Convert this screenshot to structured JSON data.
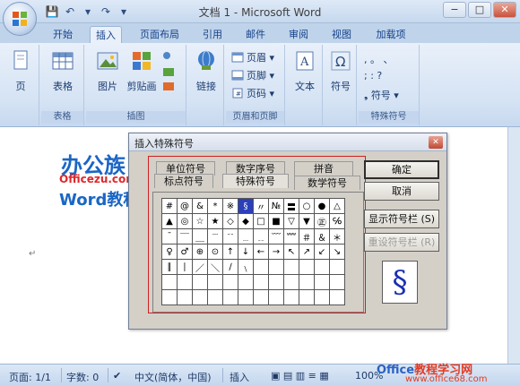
{
  "window": {
    "title": "文档 1 - Microsoft Word",
    "controls": [
      "−",
      "□",
      "✕"
    ]
  },
  "qat": [
    "💾",
    "↶",
    "▾",
    "↷",
    "▾"
  ],
  "tabs": [
    "开始",
    "插入",
    "页面布局",
    "引用",
    "邮件",
    "审阅",
    "视图",
    "加载项"
  ],
  "ribbon": {
    "groups": {
      "pages": {
        "label": "",
        "btn": "页"
      },
      "tables": {
        "label": "表格",
        "btn": "表格"
      },
      "illustrations": {
        "label": "插图",
        "picture": "图片",
        "clipart": "剪贴画"
      },
      "links": {
        "label": "",
        "btn": "链接"
      },
      "header_footer": {
        "label": "页眉和页脚",
        "header": "页眉",
        "footer": "页脚",
        "page_number": "页码"
      },
      "text": {
        "label": "",
        "btn": "文本"
      },
      "symbols": {
        "label": "",
        "btn": "符号"
      },
      "special": {
        "label": "特殊符号",
        "row1": ",  。  、",
        "row2": ";  :  ?",
        "btn": "符号"
      }
    }
  },
  "watermark": {
    "brand": "办公族",
    "site": "Officezu.com",
    "sub": "Word教程"
  },
  "dialog": {
    "title": "插入特殊符号",
    "tabs_row1": [
      "单位符号",
      "数字序号",
      "拼音"
    ],
    "tabs_row2": [
      "标点符号",
      "特殊符号",
      "数学符号"
    ],
    "symbols": [
      [
        "#",
        "@",
        "&",
        "*",
        "※",
        "§",
        "〃",
        "№",
        "〓",
        "○",
        "●",
        "△"
      ],
      [
        "▲",
        "◎",
        "☆",
        "★",
        "◇",
        "◆",
        "□",
        "■",
        "▽",
        "▼",
        "㊣",
        "℅"
      ],
      [
        "ˉ",
        "￣",
        "＿",
        "﹉",
        "﹊",
        "﹍",
        "﹎",
        "﹋",
        "﹌",
        "＃",
        "＆",
        "＊"
      ],
      [
        "♀",
        "♂",
        "⊕",
        "⊙",
        "↑",
        "↓",
        "←",
        "→",
        "↖",
        "↗",
        "↙",
        "↘"
      ],
      [
        "∥",
        "∣",
        "／",
        "＼",
        "∕",
        "﹨",
        "",
        "",
        "",
        "",
        "",
        ""
      ],
      [
        "",
        "",
        "",
        "",
        "",
        "",
        "",
        "",
        "",
        "",
        "",
        ""
      ],
      [
        "",
        "",
        "",
        "",
        "",
        "",
        "",
        "",
        "",
        "",
        "",
        ""
      ]
    ],
    "ok": "确定",
    "cancel": "取消",
    "show_bar": "显示符号栏 (S)",
    "reset_bar": "重设符号栏 (R)",
    "preview": "§"
  },
  "status": {
    "page": "页面: 1/1",
    "words": "字数: 0",
    "lang": "中文(简体，中国)",
    "mode": "插入",
    "zoom": "100%"
  },
  "footer": {
    "logo_a": "Office",
    "logo_b": "教程学习网",
    "url": "www.office68.com"
  }
}
